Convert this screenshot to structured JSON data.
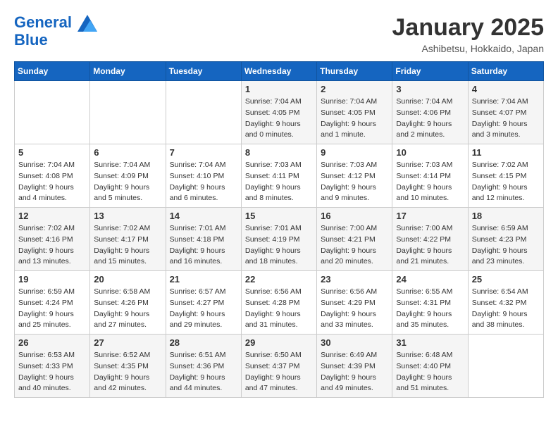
{
  "header": {
    "logo_line1": "General",
    "logo_line2": "Blue",
    "month": "January 2025",
    "location": "Ashibetsu, Hokkaido, Japan"
  },
  "weekdays": [
    "Sunday",
    "Monday",
    "Tuesday",
    "Wednesday",
    "Thursday",
    "Friday",
    "Saturday"
  ],
  "weeks": [
    [
      {
        "day": "",
        "info": ""
      },
      {
        "day": "",
        "info": ""
      },
      {
        "day": "",
        "info": ""
      },
      {
        "day": "1",
        "info": "Sunrise: 7:04 AM\nSunset: 4:05 PM\nDaylight: 9 hours\nand 0 minutes."
      },
      {
        "day": "2",
        "info": "Sunrise: 7:04 AM\nSunset: 4:05 PM\nDaylight: 9 hours\nand 1 minute."
      },
      {
        "day": "3",
        "info": "Sunrise: 7:04 AM\nSunset: 4:06 PM\nDaylight: 9 hours\nand 2 minutes."
      },
      {
        "day": "4",
        "info": "Sunrise: 7:04 AM\nSunset: 4:07 PM\nDaylight: 9 hours\nand 3 minutes."
      }
    ],
    [
      {
        "day": "5",
        "info": "Sunrise: 7:04 AM\nSunset: 4:08 PM\nDaylight: 9 hours\nand 4 minutes."
      },
      {
        "day": "6",
        "info": "Sunrise: 7:04 AM\nSunset: 4:09 PM\nDaylight: 9 hours\nand 5 minutes."
      },
      {
        "day": "7",
        "info": "Sunrise: 7:04 AM\nSunset: 4:10 PM\nDaylight: 9 hours\nand 6 minutes."
      },
      {
        "day": "8",
        "info": "Sunrise: 7:03 AM\nSunset: 4:11 PM\nDaylight: 9 hours\nand 8 minutes."
      },
      {
        "day": "9",
        "info": "Sunrise: 7:03 AM\nSunset: 4:12 PM\nDaylight: 9 hours\nand 9 minutes."
      },
      {
        "day": "10",
        "info": "Sunrise: 7:03 AM\nSunset: 4:14 PM\nDaylight: 9 hours\nand 10 minutes."
      },
      {
        "day": "11",
        "info": "Sunrise: 7:02 AM\nSunset: 4:15 PM\nDaylight: 9 hours\nand 12 minutes."
      }
    ],
    [
      {
        "day": "12",
        "info": "Sunrise: 7:02 AM\nSunset: 4:16 PM\nDaylight: 9 hours\nand 13 minutes."
      },
      {
        "day": "13",
        "info": "Sunrise: 7:02 AM\nSunset: 4:17 PM\nDaylight: 9 hours\nand 15 minutes."
      },
      {
        "day": "14",
        "info": "Sunrise: 7:01 AM\nSunset: 4:18 PM\nDaylight: 9 hours\nand 16 minutes."
      },
      {
        "day": "15",
        "info": "Sunrise: 7:01 AM\nSunset: 4:19 PM\nDaylight: 9 hours\nand 18 minutes."
      },
      {
        "day": "16",
        "info": "Sunrise: 7:00 AM\nSunset: 4:21 PM\nDaylight: 9 hours\nand 20 minutes."
      },
      {
        "day": "17",
        "info": "Sunrise: 7:00 AM\nSunset: 4:22 PM\nDaylight: 9 hours\nand 21 minutes."
      },
      {
        "day": "18",
        "info": "Sunrise: 6:59 AM\nSunset: 4:23 PM\nDaylight: 9 hours\nand 23 minutes."
      }
    ],
    [
      {
        "day": "19",
        "info": "Sunrise: 6:59 AM\nSunset: 4:24 PM\nDaylight: 9 hours\nand 25 minutes."
      },
      {
        "day": "20",
        "info": "Sunrise: 6:58 AM\nSunset: 4:26 PM\nDaylight: 9 hours\nand 27 minutes."
      },
      {
        "day": "21",
        "info": "Sunrise: 6:57 AM\nSunset: 4:27 PM\nDaylight: 9 hours\nand 29 minutes."
      },
      {
        "day": "22",
        "info": "Sunrise: 6:56 AM\nSunset: 4:28 PM\nDaylight: 9 hours\nand 31 minutes."
      },
      {
        "day": "23",
        "info": "Sunrise: 6:56 AM\nSunset: 4:29 PM\nDaylight: 9 hours\nand 33 minutes."
      },
      {
        "day": "24",
        "info": "Sunrise: 6:55 AM\nSunset: 4:31 PM\nDaylight: 9 hours\nand 35 minutes."
      },
      {
        "day": "25",
        "info": "Sunrise: 6:54 AM\nSunset: 4:32 PM\nDaylight: 9 hours\nand 38 minutes."
      }
    ],
    [
      {
        "day": "26",
        "info": "Sunrise: 6:53 AM\nSunset: 4:33 PM\nDaylight: 9 hours\nand 40 minutes."
      },
      {
        "day": "27",
        "info": "Sunrise: 6:52 AM\nSunset: 4:35 PM\nDaylight: 9 hours\nand 42 minutes."
      },
      {
        "day": "28",
        "info": "Sunrise: 6:51 AM\nSunset: 4:36 PM\nDaylight: 9 hours\nand 44 minutes."
      },
      {
        "day": "29",
        "info": "Sunrise: 6:50 AM\nSunset: 4:37 PM\nDaylight: 9 hours\nand 47 minutes."
      },
      {
        "day": "30",
        "info": "Sunrise: 6:49 AM\nSunset: 4:39 PM\nDaylight: 9 hours\nand 49 minutes."
      },
      {
        "day": "31",
        "info": "Sunrise: 6:48 AM\nSunset: 4:40 PM\nDaylight: 9 hours\nand 51 minutes."
      },
      {
        "day": "",
        "info": ""
      }
    ]
  ]
}
